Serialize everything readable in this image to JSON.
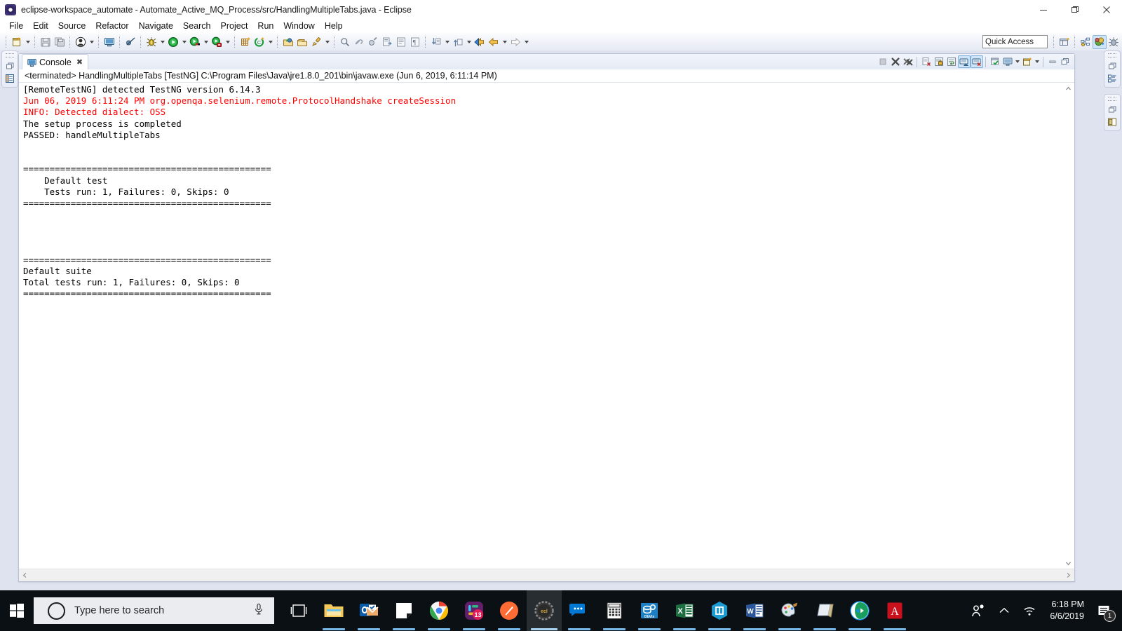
{
  "window": {
    "title": "eclipse-workspace_automate - Automate_Active_MQ_Process/src/HandlingMultipleTabs.java - Eclipse",
    "app_icon": "eclipse-icon",
    "controls": {
      "minimize": "minimize-icon",
      "maximize": "maximize-icon",
      "close": "close-icon"
    }
  },
  "menubar": {
    "items": [
      {
        "label": "File"
      },
      {
        "label": "Edit"
      },
      {
        "label": "Source"
      },
      {
        "label": "Refactor"
      },
      {
        "label": "Navigate"
      },
      {
        "label": "Search"
      },
      {
        "label": "Project"
      },
      {
        "label": "Run"
      },
      {
        "label": "Window"
      },
      {
        "label": "Help"
      }
    ]
  },
  "toolbar": {
    "quick_access_placeholder": "Quick Access",
    "groups": [
      {
        "buttons": [
          {
            "icon": "new-wizard-icon",
            "menu": true
          },
          {
            "icon": "save-icon",
            "menu": false
          },
          {
            "icon": "save-all-icon",
            "menu": false
          }
        ]
      },
      {
        "buttons": [
          {
            "icon": "user-profile-icon",
            "menu": true
          }
        ]
      },
      {
        "buttons": [
          {
            "icon": "open-console-icon",
            "menu": false
          },
          {
            "icon": "skip-breakpoints-icon",
            "menu": false
          }
        ]
      },
      {
        "buttons": [
          {
            "icon": "debug-icon",
            "menu": true
          },
          {
            "icon": "run-icon",
            "menu": true
          },
          {
            "icon": "coverage-icon",
            "menu": true
          },
          {
            "icon": "external-tools-icon",
            "menu": true
          }
        ]
      },
      {
        "buttons": [
          {
            "icon": "new-java-package-icon",
            "menu": false
          },
          {
            "icon": "new-java-class-icon",
            "menu": true
          }
        ]
      },
      {
        "buttons": [
          {
            "icon": "open-type-icon",
            "menu": false
          },
          {
            "icon": "open-task-icon",
            "menu": false
          },
          {
            "icon": "annotate-icon",
            "menu": true
          }
        ]
      },
      {
        "buttons": [
          {
            "icon": "search-icon",
            "menu": false
          },
          {
            "icon": "link-icon",
            "menu": false
          },
          {
            "icon": "toggle-mark-occurrences-icon",
            "menu": false
          },
          {
            "icon": "open-element-icon",
            "menu": false
          },
          {
            "icon": "show-whitespace-icon",
            "menu": false
          },
          {
            "icon": "block-selection-icon",
            "menu": false
          }
        ]
      },
      {
        "buttons": [
          {
            "icon": "next-annotation-icon",
            "menu": true
          },
          {
            "icon": "previous-annotation-icon",
            "menu": true
          },
          {
            "icon": "back-icon",
            "menu": false
          },
          {
            "icon": "forward-arrow-left-icon",
            "menu": true
          },
          {
            "icon": "forward-icon",
            "menu": true
          }
        ]
      }
    ],
    "perspective_buttons": [
      {
        "icon": "open-perspective-icon",
        "active": false
      },
      {
        "icon": "java-perspective-icon",
        "active": false
      },
      {
        "icon": "java-ee-perspective-icon",
        "active": true
      },
      {
        "icon": "debug-perspective-icon",
        "active": false
      }
    ]
  },
  "left_fast_view": {
    "stacks": [
      {
        "grip": "grip-dots",
        "items": [
          {
            "icon": "restore-icon"
          },
          {
            "icon": "package-explorer-icon"
          }
        ]
      }
    ]
  },
  "right_fast_view": {
    "stacks": [
      {
        "grip": "grip-dots",
        "items": [
          {
            "icon": "restore-icon"
          },
          {
            "icon": "outline-icon"
          }
        ]
      },
      {
        "grip": "grip-dots",
        "items": [
          {
            "icon": "restore-icon"
          },
          {
            "icon": "task-list-icon"
          }
        ]
      }
    ]
  },
  "console_view": {
    "tab": {
      "icon": "console-icon",
      "label": "Console",
      "close": "✖"
    },
    "process_line": "<terminated> HandlingMultipleTabs [TestNG] C:\\Program Files\\Java\\jre1.8.0_201\\bin\\javaw.exe (Jun 6, 2019, 6:11:14 PM)",
    "tools": [
      {
        "icon": "terminate-icon",
        "enabled": false,
        "active": false
      },
      {
        "icon": "remove-launch-icon",
        "enabled": true,
        "active": false
      },
      {
        "icon": "remove-all-terminated-icon",
        "enabled": true,
        "active": false
      },
      {
        "sep": true
      },
      {
        "icon": "clear-console-icon",
        "enabled": true,
        "active": false
      },
      {
        "icon": "scroll-lock-icon",
        "enabled": true,
        "active": false
      },
      {
        "icon": "word-wrap-icon",
        "enabled": true,
        "active": false
      },
      {
        "icon": "show-console-on-output-icon",
        "enabled": true,
        "active": true
      },
      {
        "icon": "show-console-on-error-icon",
        "enabled": true,
        "active": true
      },
      {
        "sep": true
      },
      {
        "icon": "pin-console-icon",
        "enabled": true,
        "active": false
      },
      {
        "icon": "display-selected-console-icon",
        "enabled": true,
        "active": false,
        "menu": true
      },
      {
        "icon": "open-console-icon",
        "enabled": true,
        "active": false,
        "menu": true
      },
      {
        "sep": true
      },
      {
        "icon": "minimize-view-icon",
        "enabled": true,
        "active": false
      },
      {
        "icon": "maximize-view-icon",
        "enabled": true,
        "active": false
      }
    ],
    "output_lines": [
      {
        "text": "[RemoteTestNG] detected TestNG version 6.14.3",
        "color": "#000000"
      },
      {
        "text": "Jun 06, 2019 6:11:24 PM org.openqa.selenium.remote.ProtocolHandshake createSession",
        "color": "#ff0000"
      },
      {
        "text": "INFO: Detected dialect: OSS",
        "color": "#ff0000"
      },
      {
        "text": "The setup process is completed",
        "color": "#000000"
      },
      {
        "text": "PASSED: handleMultipleTabs",
        "color": "#000000"
      },
      {
        "text": "",
        "color": "#000000"
      },
      {
        "text": "",
        "color": "#000000"
      },
      {
        "text": "===============================================",
        "color": "#000000"
      },
      {
        "text": "    Default test",
        "color": "#000000"
      },
      {
        "text": "    Tests run: 1, Failures: 0, Skips: 0",
        "color": "#000000"
      },
      {
        "text": "===============================================",
        "color": "#000000"
      },
      {
        "text": "",
        "color": "#000000"
      },
      {
        "text": "",
        "color": "#000000"
      },
      {
        "text": "",
        "color": "#000000"
      },
      {
        "text": "",
        "color": "#000000"
      },
      {
        "text": "===============================================",
        "color": "#000000"
      },
      {
        "text": "Default suite",
        "color": "#000000"
      },
      {
        "text": "Total tests run: 1, Failures: 0, Skips: 0",
        "color": "#000000"
      },
      {
        "text": "===============================================",
        "color": "#000000"
      }
    ],
    "scrollbars": {
      "vertical_up": "scroll-up-arrow-icon",
      "vertical_down": "scroll-down-arrow-icon",
      "horizontal_left": "scroll-left-arrow-icon",
      "horizontal_right": "scroll-right-arrow-icon"
    }
  },
  "taskbar": {
    "start": "windows-start-icon",
    "search": {
      "icon": "search-circle-icon",
      "placeholder": "Type here to search",
      "mic": "microphone-icon"
    },
    "apps": [
      {
        "name": "task-view-icon",
        "running": false,
        "focused": false
      },
      {
        "name": "file-explorer-icon",
        "running": true,
        "focused": false
      },
      {
        "name": "outlook-icon",
        "running": true,
        "focused": false
      },
      {
        "name": "sticky-notes-icon",
        "running": true,
        "focused": false
      },
      {
        "name": "google-chrome-icon",
        "running": true,
        "focused": false
      },
      {
        "name": "slack-icon",
        "running": true,
        "focused": false,
        "badge": "13"
      },
      {
        "name": "sublime-text-icon",
        "running": true,
        "focused": false
      },
      {
        "name": "eclipse-icon",
        "running": true,
        "focused": true
      },
      {
        "name": "skype-for-business-icon",
        "running": true,
        "focused": false
      },
      {
        "name": "calculator-icon",
        "running": true,
        "focused": false
      },
      {
        "name": "dbvisualizer-icon",
        "running": true,
        "focused": false
      },
      {
        "name": "excel-icon",
        "running": true,
        "focused": false
      },
      {
        "name": "sharepoint-icon",
        "running": true,
        "focused": false
      },
      {
        "name": "word-icon",
        "running": true,
        "focused": false
      },
      {
        "name": "paint-icon",
        "running": true,
        "focused": false
      },
      {
        "name": "notepad-icon",
        "running": true,
        "focused": false
      },
      {
        "name": "teamviewer-icon",
        "running": true,
        "focused": false
      },
      {
        "name": "adobe-reader-icon",
        "running": true,
        "focused": false
      }
    ],
    "tray": {
      "people": "people-icon",
      "show_hidden": "show-hidden-icons-chevron",
      "network": "wifi-icon",
      "time": "6:18 PM",
      "date": "6/6/2019",
      "notifications": {
        "icon": "action-center-icon",
        "count": "1"
      }
    }
  }
}
